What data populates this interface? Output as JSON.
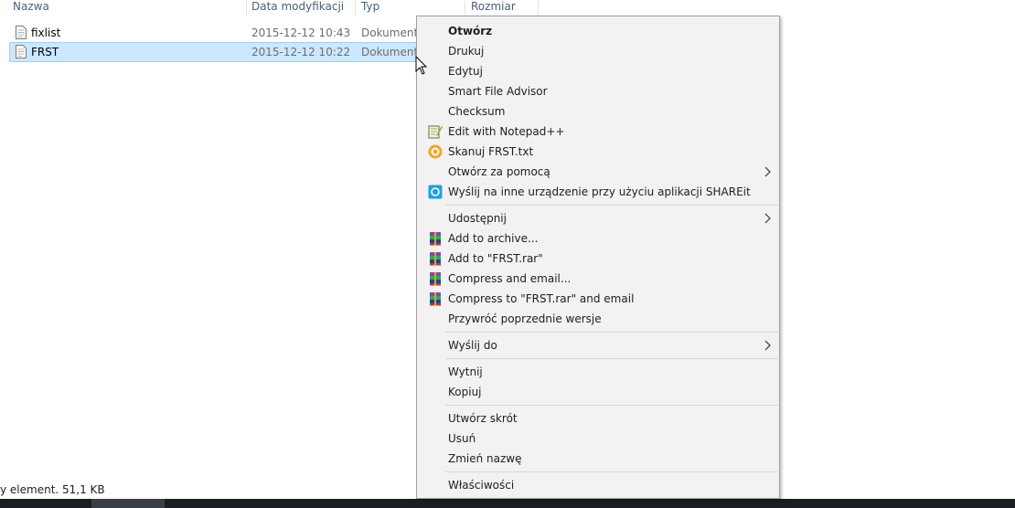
{
  "columns": {
    "name": "Nazwa",
    "date": "Data modyfikacji",
    "type": "Typ",
    "size": "Rozmiar"
  },
  "files": [
    {
      "name": "fixlist",
      "date": "2015-12-12 10:43",
      "type": "Dokument tekstowy"
    },
    {
      "name": "FRST",
      "date": "2015-12-12 10:22",
      "type": "Dokument tekstowy"
    }
  ],
  "status": "y element. 51,1 KB",
  "menu": {
    "open": "Otwórz",
    "print": "Drukuj",
    "edit": "Edytuj",
    "smart_file_advisor": "Smart File Advisor",
    "checksum": "Checksum",
    "edit_notepad": "Edit with Notepad++",
    "scan": "Skanuj FRST.txt",
    "open_with": "Otwórz za pomocą",
    "shareit": "Wyślij na inne urządzenie przy użyciu aplikacji SHAREit",
    "share": "Udostępnij",
    "add_archive": "Add to archive...",
    "add_rar": "Add to \"FRST.rar\"",
    "compress_email": "Compress and email...",
    "compress_rar_email": "Compress to \"FRST.rar\" and email",
    "restore_versions": "Przywróć poprzednie wersje",
    "send_to": "Wyślij do",
    "cut": "Wytnij",
    "copy": "Kopiuj",
    "create_shortcut": "Utwórz skrót",
    "delete": "Usuń",
    "rename": "Zmień nazwę",
    "properties": "Właściwości"
  },
  "colors": {
    "selection": "#cce8ff",
    "menu_bg": "#f2f2f2",
    "header_text": "#4c607a"
  }
}
